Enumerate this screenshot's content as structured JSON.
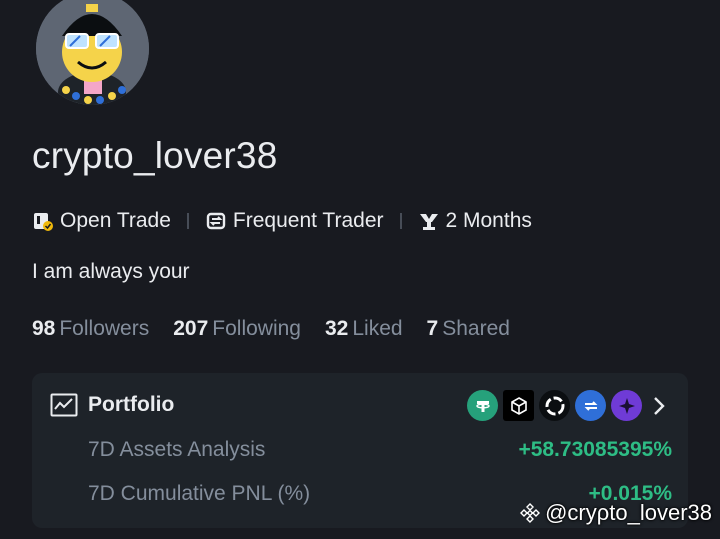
{
  "profile": {
    "username": "crypto_lover38",
    "bio": "I am always your",
    "avatar_icon": "smiley-sunglasses-avatar"
  },
  "badges": [
    {
      "icon": "open-trade-icon",
      "label": "Open Trade"
    },
    {
      "icon": "frequent-trader-icon",
      "label": "Frequent Trader"
    },
    {
      "icon": "trophy-icon",
      "label": "2 Months"
    }
  ],
  "stats": [
    {
      "value": "98",
      "label": "Followers"
    },
    {
      "value": "207",
      "label": "Following"
    },
    {
      "value": "32",
      "label": "Liked"
    },
    {
      "value": "7",
      "label": "Shared"
    }
  ],
  "portfolio": {
    "title": "Portfolio",
    "coins": [
      {
        "icon": "tether-coin-icon",
        "color": "#26a17b"
      },
      {
        "icon": "cube-coin-icon",
        "color": "#000000"
      },
      {
        "icon": "ring-coin-icon",
        "color": "#0b0e11"
      },
      {
        "icon": "swirl-coin-icon",
        "color": "#2f6fd8"
      },
      {
        "icon": "star-coin-icon",
        "color": "#6f3bd6"
      }
    ],
    "rows": [
      {
        "label": "7D Assets Analysis",
        "value": "+58.73085395%"
      },
      {
        "label": "7D Cumulative PNL (%)",
        "value": "+0.015%"
      }
    ]
  },
  "watermark": "@cryρto_lover38",
  "colors": {
    "background": "#181a20",
    "card": "#1e2329",
    "positive": "#2ebd85",
    "muted": "#848e9c"
  }
}
